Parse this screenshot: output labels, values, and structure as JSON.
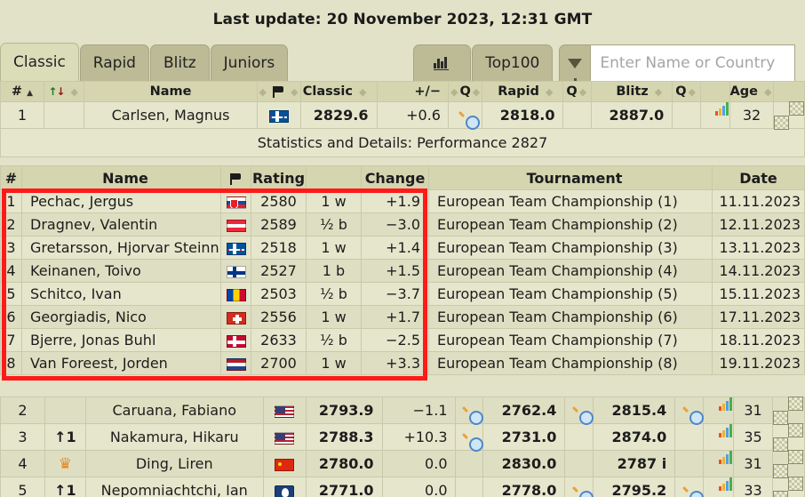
{
  "header": {
    "last_update": "Last update: 20 November 2023, 12:31 GMT"
  },
  "tabs": {
    "classic": "Classic",
    "rapid": "Rapid",
    "blitz": "Blitz",
    "juniors": "Juniors",
    "chart_icon": "bar-chart-icon",
    "top100": "Top100",
    "filter_icon": "funnel-icon"
  },
  "search": {
    "placeholder": "Enter Name or Country",
    "value": ""
  },
  "main_table": {
    "columns": {
      "rank": "#",
      "move": "",
      "name": "Name",
      "flag": "flag-icon",
      "classic": "Classic",
      "plusminus": "+/−",
      "q1": "Q",
      "rapid": "Rapid",
      "q2": "Q",
      "blitz": "Blitz",
      "q3": "Q",
      "age": "Age"
    },
    "rows": [
      {
        "rank": "1",
        "move": "",
        "crown": false,
        "name": "Carlsen, Magnus",
        "flag": "no",
        "flag_name": "flag-norway",
        "classic": "2829.6",
        "pm": "+0.6",
        "pm_sign": "pos",
        "q1": true,
        "q1_selected": true,
        "rapid": "2818.0",
        "q2": false,
        "blitz": "2887.0",
        "q3": false,
        "chart": true,
        "age": "32"
      },
      {
        "rank": "2",
        "move": "",
        "crown": false,
        "name": "Caruana, Fabiano",
        "flag": "us",
        "flag_name": "flag-usa",
        "classic": "2793.9",
        "pm": "−1.1",
        "pm_sign": "neg",
        "q1": true,
        "q1_selected": false,
        "rapid": "2762.4",
        "q2": true,
        "blitz": "2815.4",
        "q3": true,
        "chart": true,
        "age": "31"
      },
      {
        "rank": "3",
        "move": "↑1",
        "crown": false,
        "name": "Nakamura, Hikaru",
        "flag": "us",
        "flag_name": "flag-usa",
        "classic": "2788.3",
        "pm": "+10.3",
        "pm_sign": "pos",
        "q1": true,
        "q1_selected": false,
        "rapid": "2731.0",
        "q2": false,
        "blitz": "2874.0",
        "q3": false,
        "chart": true,
        "age": "35"
      },
      {
        "rank": "4",
        "move": "",
        "crown": true,
        "name": "Ding, Liren",
        "flag": "cn",
        "flag_name": "flag-china",
        "classic": "2780.0",
        "pm": "0.0",
        "pm_sign": "zero",
        "q1": false,
        "q1_selected": false,
        "rapid": "2830.0",
        "q2": false,
        "blitz": "2787 i",
        "q3": false,
        "chart": true,
        "age": "31"
      },
      {
        "rank": "5",
        "move": "↑1",
        "crown": false,
        "name": "Nepomniachtchi, Ian",
        "flag": "fide",
        "flag_name": "flag-fide",
        "classic": "2771.0",
        "pm": "0.0",
        "pm_sign": "zero",
        "q1": false,
        "q1_selected": false,
        "rapid": "2778.0",
        "q2": true,
        "blitz": "2795.2",
        "q3": true,
        "chart": true,
        "age": "33"
      }
    ],
    "stats_row": "Statistics and Details: Performance 2827"
  },
  "detail_table": {
    "columns": {
      "num": "#",
      "name": "Name",
      "flag": "flag-icon",
      "rating": "Rating",
      "change": "Change",
      "tournament": "Tournament",
      "date": "Date"
    },
    "rows": [
      {
        "num": "1",
        "name": "Pechac, Jergus",
        "flag": "sk",
        "flag_name": "flag-slovakia",
        "rating": "2580",
        "result": "1 w",
        "change": "+1.9",
        "sign": "pos",
        "tournament": "European Team Championship (1)",
        "date": "11.11.2023"
      },
      {
        "num": "2",
        "name": "Dragnev, Valentin",
        "flag": "at",
        "flag_name": "flag-austria",
        "rating": "2589",
        "result": "½ b",
        "change": "−3.0",
        "sign": "neg",
        "tournament": "European Team Championship (2)",
        "date": "12.11.2023"
      },
      {
        "num": "3",
        "name": "Gretarsson, Hjorvar Steinn",
        "flag": "is",
        "flag_name": "flag-iceland",
        "rating": "2518",
        "result": "1 w",
        "change": "+1.4",
        "sign": "pos",
        "tournament": "European Team Championship (3)",
        "date": "13.11.2023"
      },
      {
        "num": "4",
        "name": "Keinanen, Toivo",
        "flag": "fi",
        "flag_name": "flag-finland",
        "rating": "2527",
        "result": "1 b",
        "change": "+1.5",
        "sign": "pos",
        "tournament": "European Team Championship (4)",
        "date": "14.11.2023"
      },
      {
        "num": "5",
        "name": "Schitco, Ivan",
        "flag": "md",
        "flag_name": "flag-moldova",
        "rating": "2503",
        "result": "½ b",
        "change": "−3.7",
        "sign": "neg",
        "tournament": "European Team Championship (5)",
        "date": "15.11.2023"
      },
      {
        "num": "6",
        "name": "Georgiadis, Nico",
        "flag": "ch",
        "flag_name": "flag-switzerland",
        "rating": "2556",
        "result": "1 w",
        "change": "+1.7",
        "sign": "pos",
        "tournament": "European Team Championship (6)",
        "date": "17.11.2023"
      },
      {
        "num": "7",
        "name": "Bjerre, Jonas Buhl",
        "flag": "dk",
        "flag_name": "flag-denmark",
        "rating": "2633",
        "result": "½ b",
        "change": "−2.5",
        "sign": "neg",
        "tournament": "European Team Championship (7)",
        "date": "18.11.2023"
      },
      {
        "num": "8",
        "name": "Van Foreest, Jorden",
        "flag": "nl",
        "flag_name": "flag-netherlands",
        "rating": "2700",
        "result": "1 w",
        "change": "+3.3",
        "sign": "pos",
        "tournament": "European Team Championship (8)",
        "date": "19.11.2023"
      }
    ]
  },
  "colors": {
    "page_bg": "#e2e2c8",
    "header_bg": "#d5d5b0",
    "row_odd": "#e6e6cd",
    "row_even": "#dedfc2",
    "tab_inactive": "#bdbb96",
    "tab_active": "#dbdcb8",
    "positive": "#1a7a1a",
    "negative": "#9a1414",
    "rapid": "#8b1a1a",
    "blitz": "#1565a8",
    "highlight_border": "#ff1a1a"
  }
}
